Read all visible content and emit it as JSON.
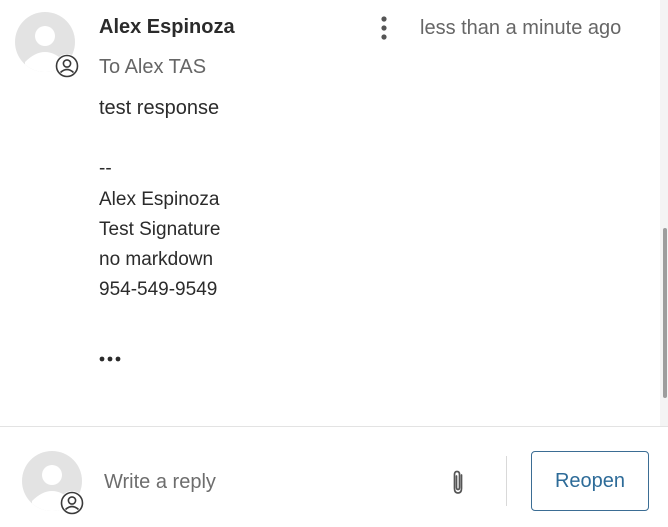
{
  "message": {
    "sender_name": "Alex Espinoza",
    "recipient": "To Alex TAS",
    "timestamp": "less than a minute ago",
    "body": "test response",
    "signature_separator": "--",
    "signature_lines": [
      "Alex Espinoza",
      "Test Signature",
      "no markdown",
      "954-549-9549"
    ],
    "more_menu_icon": "kebab-vertical-icon",
    "expand_icon": "ellipsis-horizontal-icon"
  },
  "reply": {
    "placeholder": "Write a reply",
    "attach_icon": "paperclip-icon",
    "reopen_label": "Reopen"
  },
  "colors": {
    "accent": "#2d6b98",
    "avatar_bg": "#e3e3e3",
    "text": "#2b2b2b",
    "muted_text": "#666666"
  }
}
